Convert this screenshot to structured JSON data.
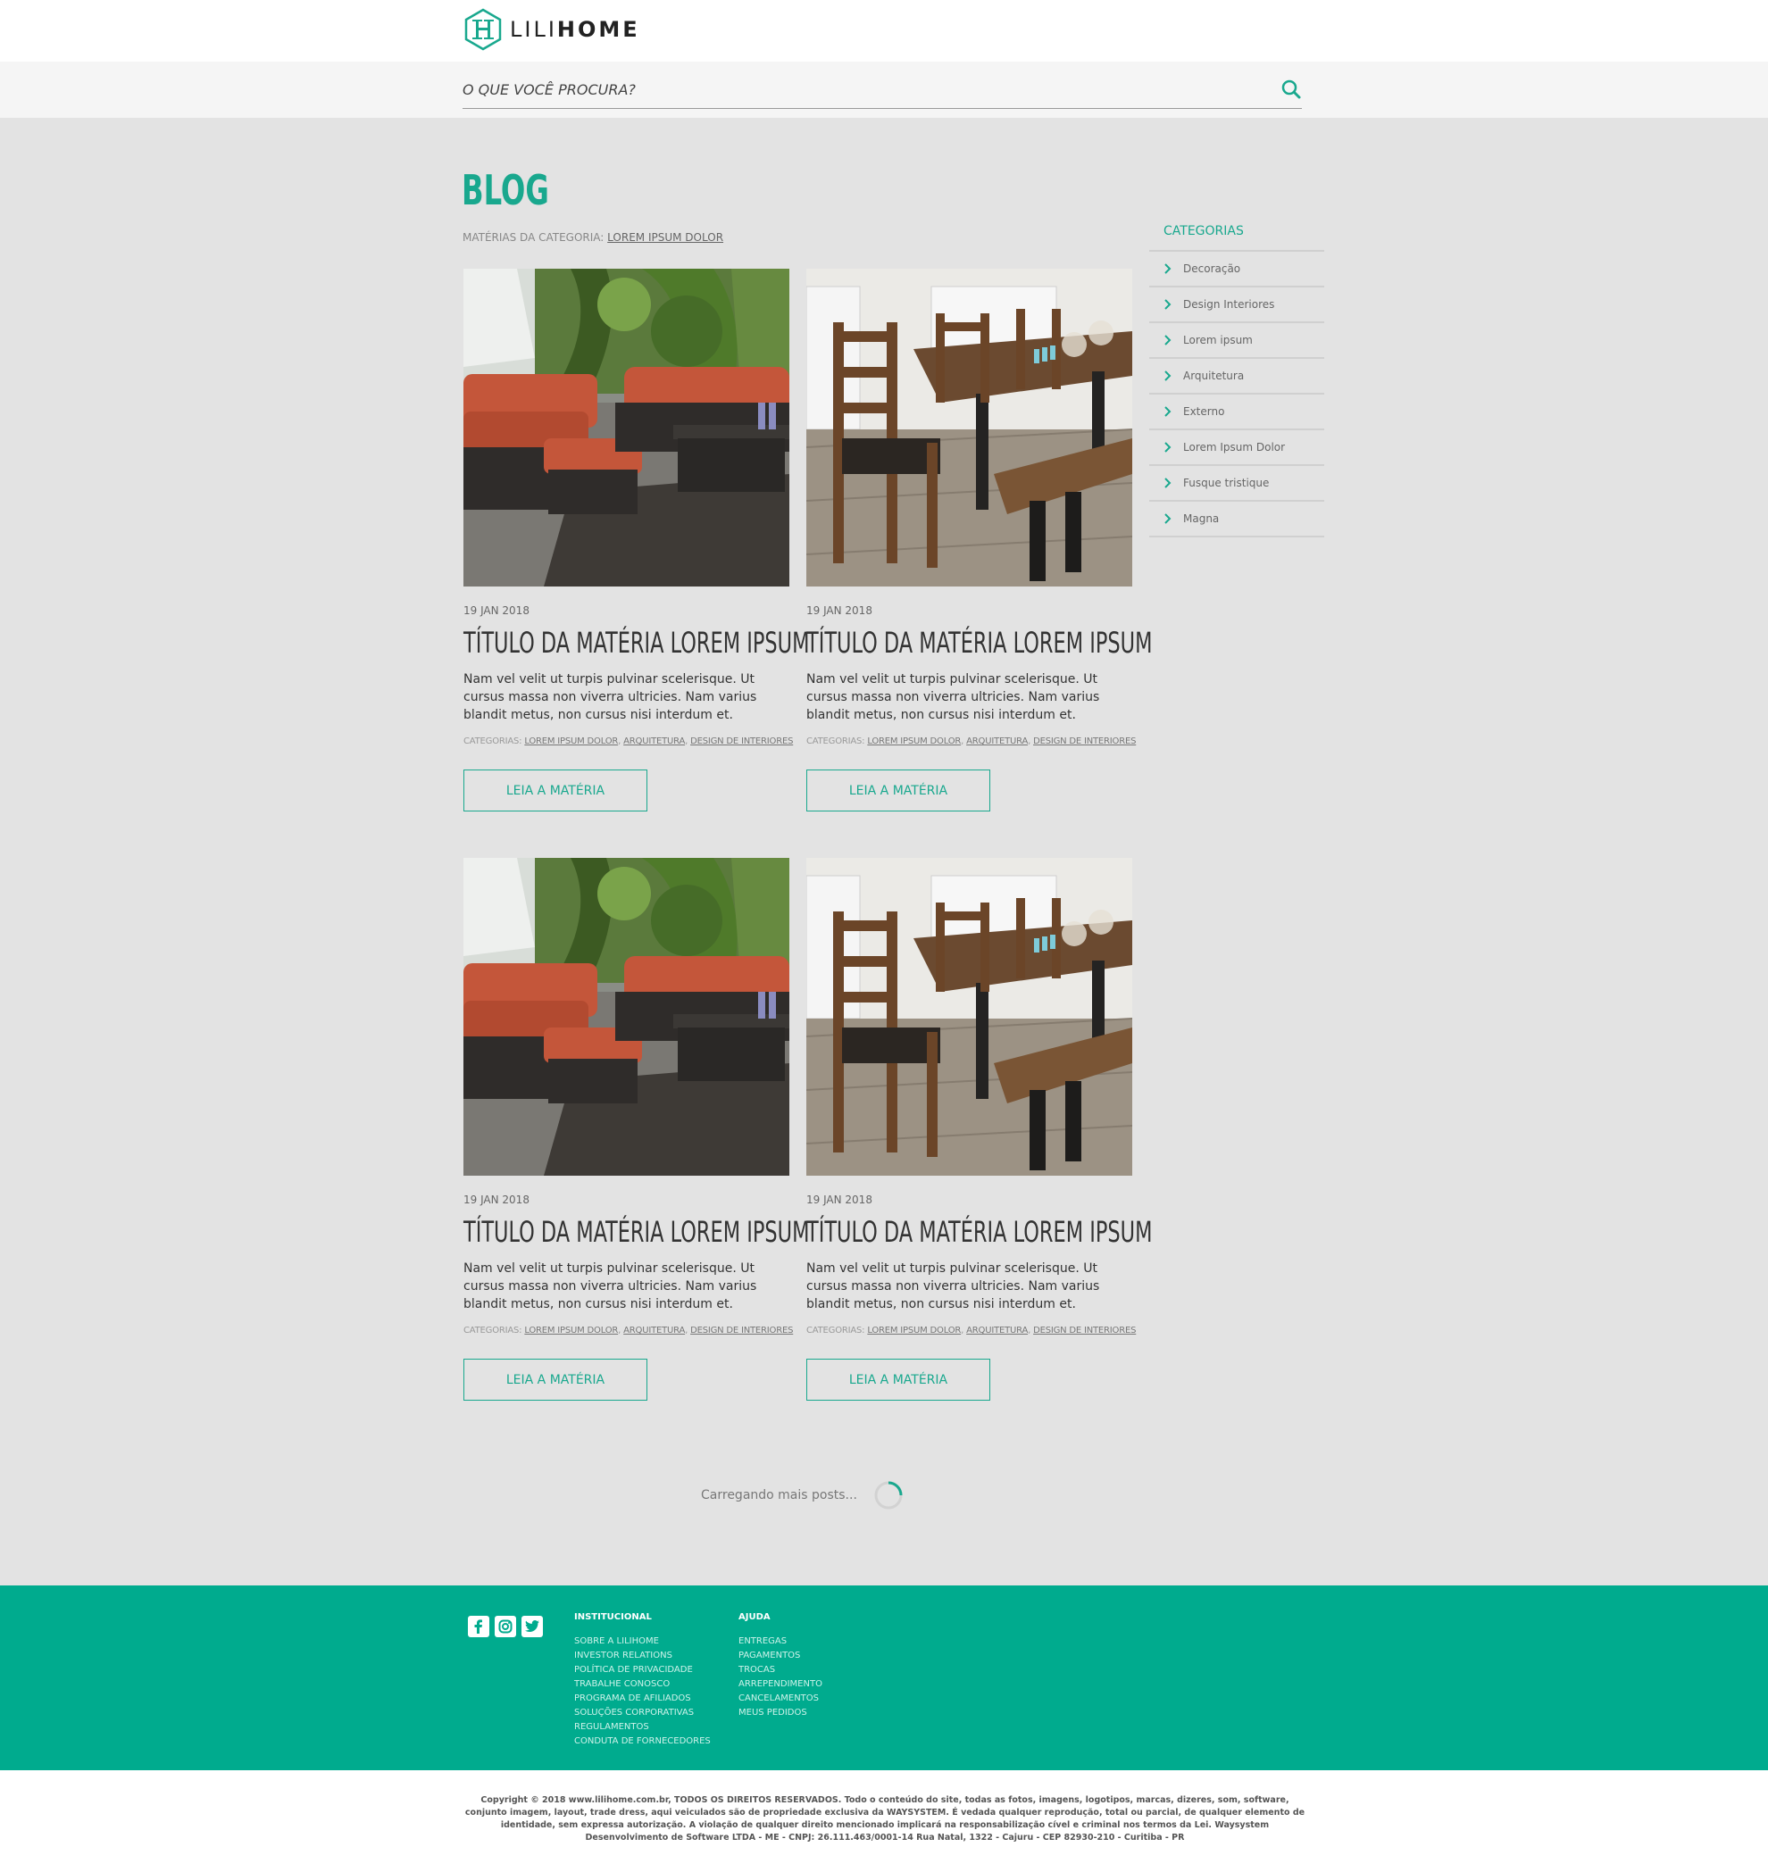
{
  "brand": {
    "logo_light": "LILI",
    "logo_bold": "HOME",
    "accent": "#19a88e",
    "footer_bg": "#00ab8e"
  },
  "search": {
    "placeholder": "O QUE VOCÊ PROCURA?"
  },
  "page": {
    "title": "BLOG",
    "category_prefix": "MATÉRIAS DA CATEGORIA:",
    "category_name": "LOREM IPSUM DOLOR"
  },
  "posts": [
    {
      "image": "outdoor-patio-furniture",
      "date": "19 JAN 2018",
      "title": "TÍTULO DA MATÉRIA LOREM IPSUM",
      "excerpt": "Nam vel velit ut turpis pulvinar scelerisque. Ut cursus massa non viverra ultricies. Nam varius blandit metus, non cursus nisi interdum et.",
      "cats_prefix": "CATEGORIAS:",
      "cats": [
        "LOREM IPSUM DOLOR",
        "ARQUITETURA",
        "DESIGN DE INTERIORES"
      ],
      "button": "LEIA A MATÉRIA"
    },
    {
      "image": "wooden-dining-table",
      "date": "19 JAN 2018",
      "title": "TÍTULO DA MATÉRIA LOREM IPSUM",
      "excerpt": "Nam vel velit ut turpis pulvinar scelerisque. Ut cursus massa non viverra ultricies. Nam varius blandit metus, non cursus nisi interdum et.",
      "cats_prefix": "CATEGORIAS:",
      "cats": [
        "LOREM IPSUM DOLOR",
        "ARQUITETURA",
        "DESIGN DE INTERIORES"
      ],
      "button": "LEIA A MATÉRIA"
    },
    {
      "image": "outdoor-patio-furniture",
      "date": "19 JAN 2018",
      "title": "TÍTULO DA MATÉRIA LOREM IPSUM",
      "excerpt": "Nam vel velit ut turpis pulvinar scelerisque. Ut cursus massa non viverra ultricies. Nam varius blandit metus, non cursus nisi interdum et.",
      "cats_prefix": "CATEGORIAS:",
      "cats": [
        "LOREM IPSUM DOLOR",
        "ARQUITETURA",
        "DESIGN DE INTERIORES"
      ],
      "button": "LEIA A MATÉRIA"
    },
    {
      "image": "wooden-dining-table",
      "date": "19 JAN 2018",
      "title": "TÍTULO DA MATÉRIA LOREM IPSUM",
      "excerpt": "Nam vel velit ut turpis pulvinar scelerisque. Ut cursus massa non viverra ultricies. Nam varius blandit metus, non cursus nisi interdum et.",
      "cats_prefix": "CATEGORIAS:",
      "cats": [
        "LOREM IPSUM DOLOR",
        "ARQUITETURA",
        "DESIGN DE INTERIORES"
      ],
      "button": "LEIA A MATÉRIA"
    }
  ],
  "sidebar": {
    "title": "CATEGORIAS",
    "items": [
      {
        "label": "Decoração"
      },
      {
        "label": "Design Interiores"
      },
      {
        "label": "Lorem ipsum"
      },
      {
        "label": "Arquitetura"
      },
      {
        "label": "Externo"
      },
      {
        "label": "Lorem Ipsum Dolor"
      },
      {
        "label": "Fusque tristique"
      },
      {
        "label": "Magna"
      }
    ]
  },
  "loader": {
    "text": "Carregando mais posts..."
  },
  "footer": {
    "social": [
      "facebook-icon",
      "instagram-icon",
      "twitter-icon"
    ],
    "institucional": {
      "title": "INSTITUCIONAL",
      "links": [
        "SOBRE A LILIHOME",
        "INVESTOR RELATIONS",
        "POLÍTICA DE PRIVACIDADE",
        "TRABALHE CONOSCO",
        "PROGRAMA DE AFILIADOS",
        "SOLUÇÕES CORPORATIVAS",
        "REGULAMENTOS",
        "CONDUTA DE FORNECEDORES"
      ]
    },
    "ajuda": {
      "title": "AJUDA",
      "links": [
        "ENTREGAS",
        "PAGAMENTOS",
        "TROCAS",
        "ARREPENDIMENTO",
        "CANCELAMENTOS",
        "MEUS PEDIDOS"
      ]
    },
    "copyright": "Copyright © 2018 www.lilihome.com.br, TODOS OS DIREITOS RESERVADOS. Todo o conteúdo do site, todas as fotos, imagens, logotipos, marcas, dizeres, som, software, conjunto imagem, layout, trade dress, aqui veiculados são de propriedade exclusiva da WAYSYSTEM. É vedada qualquer reprodução, total ou parcial, de qualquer elemento de identidade, sem expressa autorização. A violação de qualquer direito mencionado implicará na responsabilização cível e criminal nos termos da Lei. Waysystem Desenvolvimento de Software LTDA - ME - CNPJ: 26.111.463/0001-14 Rua Natal, 1322 - Cajuru - CEP 82930-210 - Curitiba - PR"
  }
}
